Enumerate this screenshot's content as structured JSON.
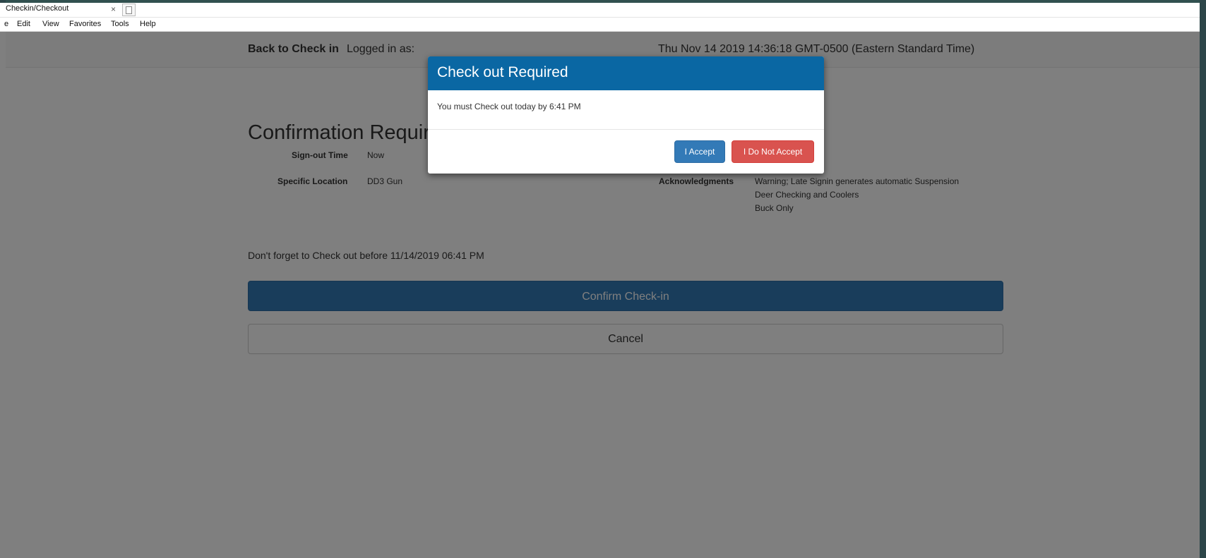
{
  "browser": {
    "tab_title": "Checkin/Checkout",
    "tab_close": "×",
    "menu": [
      "e",
      "Edit",
      "View",
      "Favorites",
      "Tools",
      "Help"
    ]
  },
  "header": {
    "back_link": "Back to Check in",
    "logged_in_label": "Logged in as:",
    "datetime": "Thu Nov 14 2019 14:36:18 GMT-0500 (Eastern Standard Time)"
  },
  "main": {
    "title": "Confirmation Required",
    "signout_label": "Sign-out Time",
    "signout_value": "Now",
    "location_label": "Specific Location",
    "location_value": "DD3 Gun",
    "ack_label": "Acknowledgments",
    "acknowledgments": [
      "Warning; Late Signin generates automatic Suspension",
      "Deer Checking and Coolers",
      "Buck Only"
    ],
    "checkout_note": "Don't forget to Check out before 11/14/2019 06:41 PM",
    "confirm_button": "Confirm Check-in",
    "cancel_button": "Cancel"
  },
  "modal": {
    "title": "Check out Required",
    "message": "You must Check out today by 6:41 PM",
    "accept_button": "I Accept",
    "decline_button": "I Do Not Accept"
  },
  "colors": {
    "primary": "#337ab7",
    "modal_header": "#0a67a3",
    "danger": "#d9534f",
    "overlay": "rgba(0,0,0,0.5)"
  }
}
